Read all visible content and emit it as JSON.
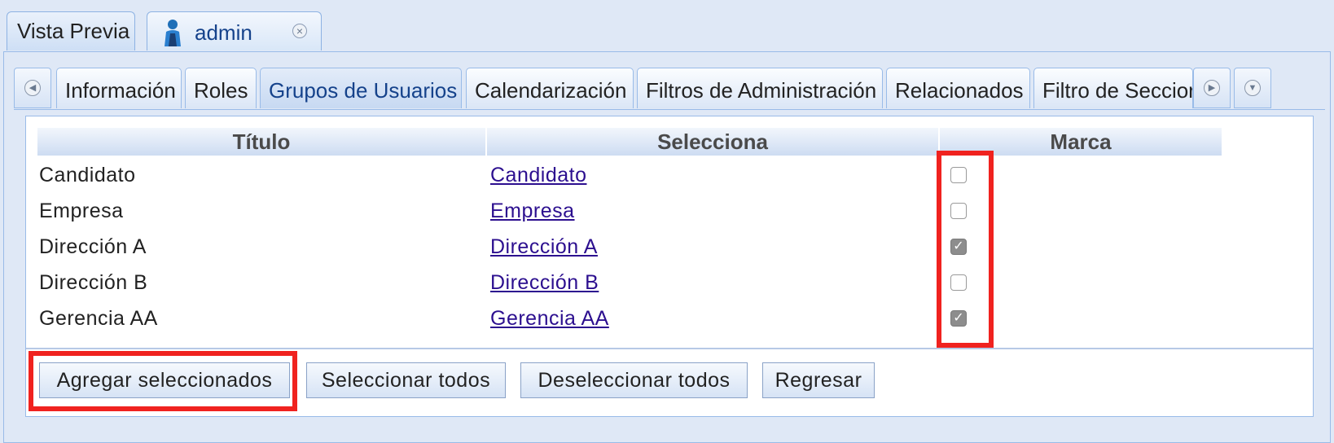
{
  "top_tabs": [
    {
      "label": "Vista Previa"
    },
    {
      "label": "admin"
    }
  ],
  "sub_tabs": [
    {
      "label": "Información"
    },
    {
      "label": "Roles"
    },
    {
      "label": "Grupos de Usuarios"
    },
    {
      "label": "Calendarización"
    },
    {
      "label": "Filtros de Administración"
    },
    {
      "label": "Relacionados"
    },
    {
      "label": "Filtro de Seccior"
    }
  ],
  "active_sub_tab": "Grupos de Usuarios",
  "grid": {
    "columns": [
      "Título",
      "Selecciona",
      "Marca"
    ],
    "rows": [
      {
        "titulo": "Candidato",
        "selecciona": "Candidato",
        "marca": false
      },
      {
        "titulo": "Empresa",
        "selecciona": "Empresa",
        "marca": false
      },
      {
        "titulo": "Dirección A",
        "selecciona": "Dirección A",
        "marca": true
      },
      {
        "titulo": "Dirección B",
        "selecciona": "Dirección B",
        "marca": false
      },
      {
        "titulo": "Gerencia AA",
        "selecciona": "Gerencia AA",
        "marca": true
      }
    ]
  },
  "buttons": {
    "agregar": "Agregar seleccionados",
    "seleccionar_todos": "Seleccionar todos",
    "deseleccionar_todos": "Deseleccionar todos",
    "regresar": "Regresar"
  },
  "icons": {
    "user": "user-icon",
    "close": "close-icon",
    "scroll_left": "scroll-left-icon",
    "scroll_right": "scroll-right-icon",
    "tab_menu": "tab-menu-icon"
  },
  "colors": {
    "highlight": "#f0221f",
    "link": "#2c0f8f",
    "header_text": "#15428b"
  }
}
